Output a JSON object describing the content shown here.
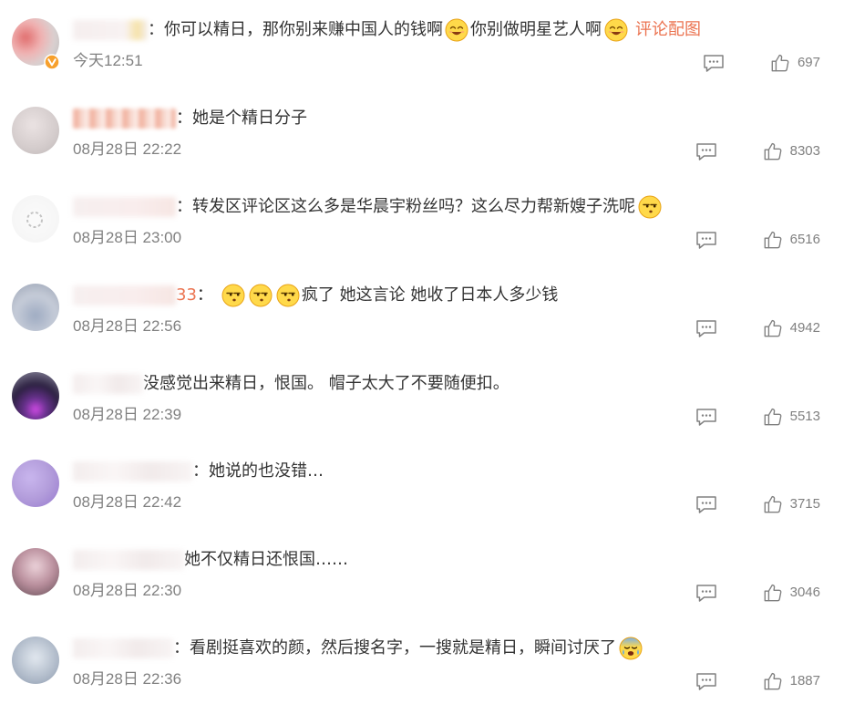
{
  "colors": {
    "text": "#333333",
    "username": "#eb7350",
    "link": "#eb7350",
    "meta": "#808080",
    "background": "#ffffff"
  },
  "icons": {
    "reply": "comment-icon",
    "like": "thumbs-up-icon",
    "verified": "verified-badge-icon"
  },
  "comments": [
    {
      "verified": true,
      "sep": "：",
      "text_a": "你可以精日，那你别来赚中国人的钱啊",
      "emoji_a": "smile-emoji",
      "text_b": "你别做明星艺人啊",
      "emoji_b": "smile-emoji",
      "link": "评论配图",
      "time": "今天12:51",
      "likes": "697"
    },
    {
      "sep": "：",
      "text_a": "她是个精日分子",
      "time": "08月28日 22:22",
      "likes": "8303"
    },
    {
      "sep": "：",
      "text_a": "转发区评论区这么多是华晨宇粉丝吗？这么尽力帮新嫂子洗呢",
      "emoji_a": "smirk-emoji",
      "time": "08月28日 23:00",
      "likes": "6516"
    },
    {
      "name_tail": "33",
      "sep": "：",
      "emojis": [
        "smirk-emoji",
        "smirk-emoji",
        "smirk-emoji"
      ],
      "text_a": "疯了 她这言论 她收了日本人多少钱",
      "time": "08月28日 22:56",
      "likes": "4942"
    },
    {
      "text_a": "没感觉出来精日，恨国。 帽子太大了不要随便扣。",
      "time": "08月28日 22:39",
      "likes": "5513"
    },
    {
      "sep": "：",
      "text_a": "她说的也没错…",
      "time": "08月28日 22:42",
      "likes": "3715"
    },
    {
      "text_a": "她不仅精日还恨国……",
      "time": "08月28日 22:30",
      "likes": "3046"
    },
    {
      "sep": "：",
      "text_a": "看剧挺喜欢的颜，然后搜名字，一搜就是精日，瞬间讨厌了",
      "emoji_a": "crying-emoji",
      "time": "08月28日 22:36",
      "likes": "1887"
    }
  ]
}
